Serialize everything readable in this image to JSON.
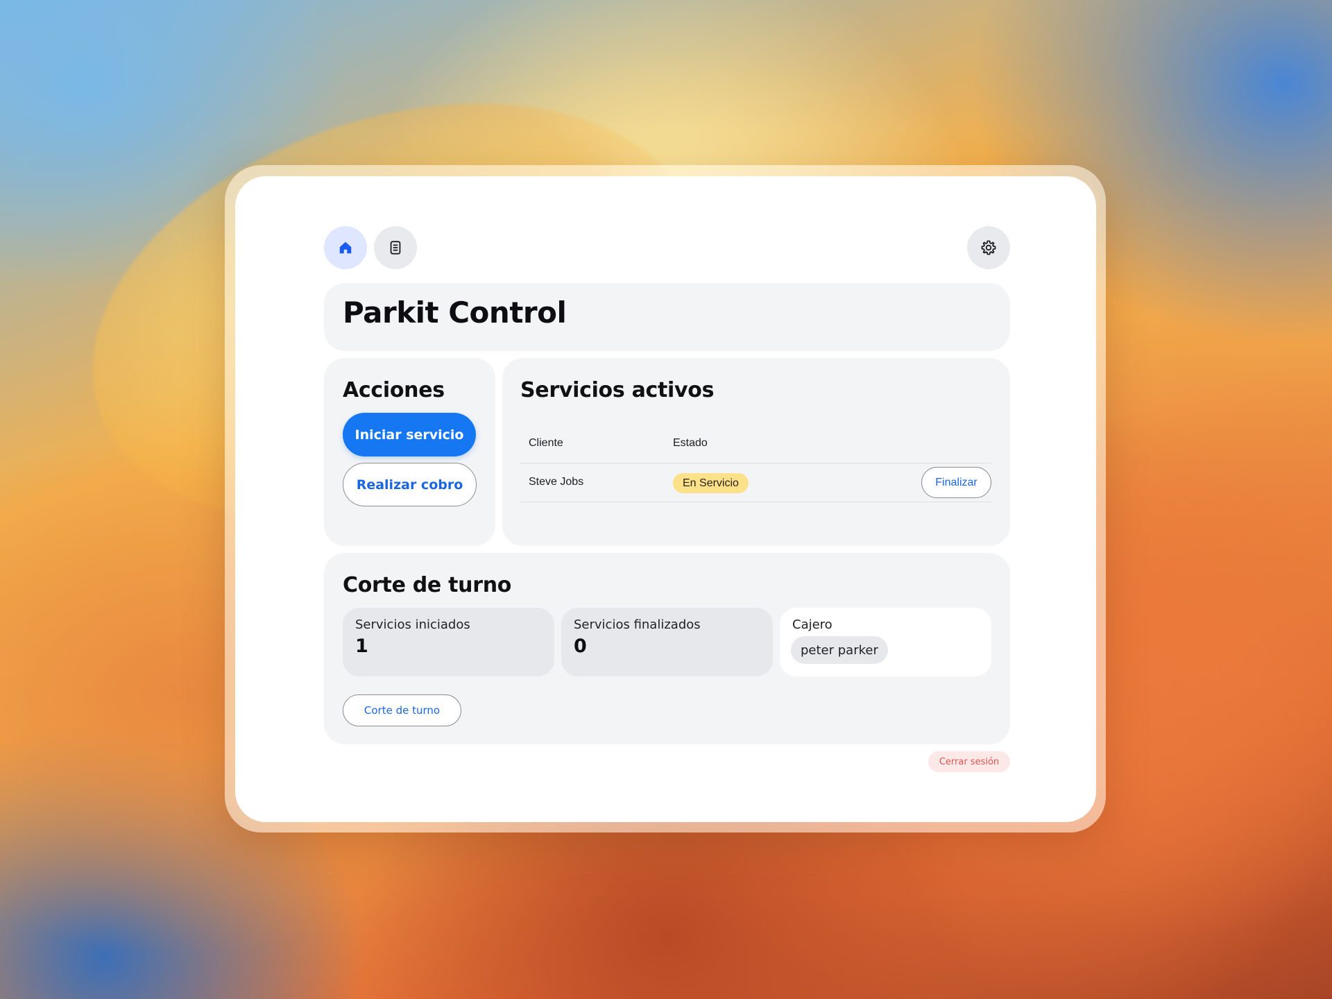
{
  "app": {
    "title": "Parkit Control"
  },
  "nav": {
    "items": [
      {
        "icon": "home-icon",
        "active": true
      },
      {
        "icon": "document-icon",
        "active": false
      }
    ],
    "settings_icon": "gear-icon"
  },
  "actions": {
    "heading": "Acciones",
    "start_service": "Iniciar servicio",
    "charge": "Realizar cobro"
  },
  "active_services": {
    "heading": "Servicios activos",
    "columns": [
      "Cliente",
      "Estado"
    ],
    "rows": [
      {
        "client": "Steve Jobs",
        "status": "En Servicio",
        "action": "Finalizar"
      }
    ]
  },
  "shift": {
    "heading": "Corte de turno",
    "started_label": "Servicios iniciados",
    "started_value": "1",
    "finished_label": "Servicios finalizados",
    "finished_value": "0",
    "cashier_label": "Cajero",
    "cashier_name": "peter parker",
    "button": "Corte de turno"
  },
  "logout": "Cerrar sesión",
  "colors": {
    "accent": "#1677f2",
    "status_badge": "#fde08a",
    "logout": "#e0534f"
  }
}
